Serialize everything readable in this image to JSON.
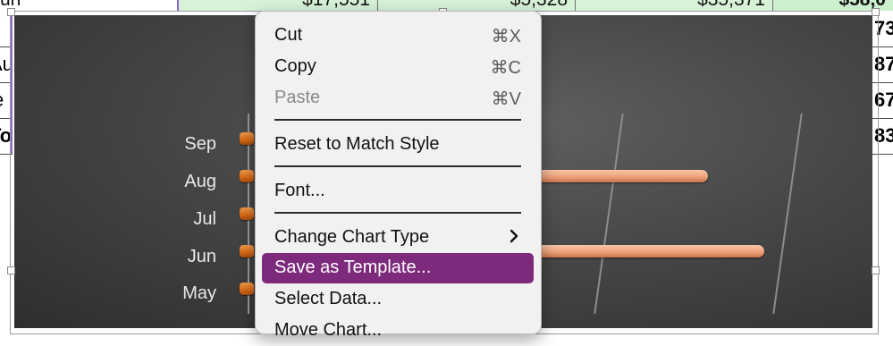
{
  "spreadsheet": {
    "top_row": [
      "un",
      "$17,551",
      "$5,328",
      "$35,371",
      "$58,0"
    ],
    "left_stubs": [
      "u",
      "Au",
      "e",
      "To"
    ],
    "right_stubs": [
      "73",
      "87",
      "67",
      "83"
    ]
  },
  "chart": {
    "categories": [
      "Sep",
      "Aug",
      "Jul",
      "Jun",
      "May"
    ]
  },
  "context_menu": {
    "items": [
      {
        "label": "Cut",
        "shortcut": "⌘X",
        "enabled": true
      },
      {
        "label": "Copy",
        "shortcut": "⌘C",
        "enabled": true
      },
      {
        "label": "Paste",
        "shortcut": "⌘V",
        "enabled": false
      },
      {
        "label": "Reset to Match Style",
        "shortcut": "",
        "enabled": true
      },
      {
        "label": "Font...",
        "shortcut": "",
        "enabled": true
      },
      {
        "label": "Change Chart Type",
        "shortcut": "",
        "submenu": true,
        "enabled": true
      },
      {
        "label": "Save as Template...",
        "shortcut": "",
        "highlighted": true,
        "enabled": true
      },
      {
        "label": "Select Data...",
        "shortcut": "",
        "enabled": true
      },
      {
        "label": "Move Chart...",
        "shortcut": "",
        "enabled": true
      }
    ],
    "highlight_color": "#7e2a7c",
    "submenu_icon": "chevron-right-icon"
  },
  "colors": {
    "chart_background": "#474747",
    "bar_fill": "#eda27a",
    "bar_cap": "#d86a17",
    "cell_green": "#d8f2d8"
  }
}
